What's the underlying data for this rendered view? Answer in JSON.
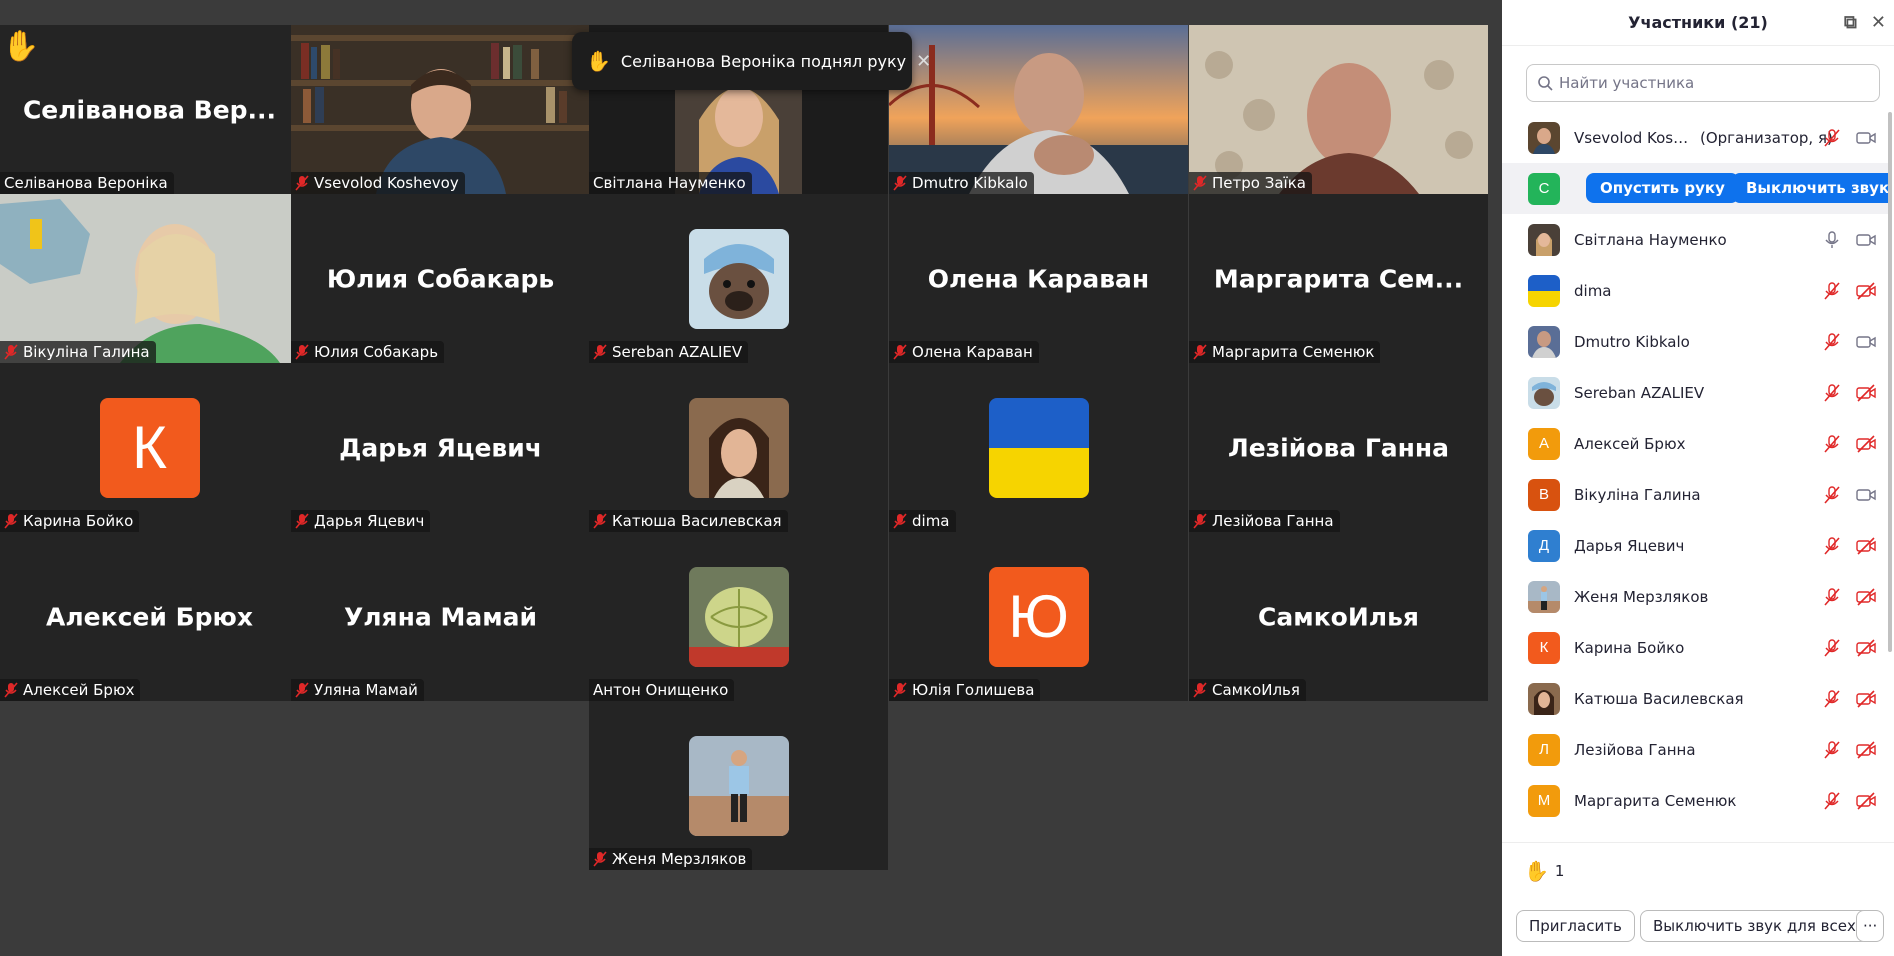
{
  "toast": {
    "text": "Селіванова Вероніка поднял руку"
  },
  "tiles": [
    {
      "label": "Селіванова Вероніка",
      "big": "Селіванова  Вер...",
      "muted": false
    },
    {
      "label": "Vsevolod Koshevoy",
      "muted": true
    },
    {
      "label": "Світлана Науменко",
      "muted": false
    },
    {
      "label": "Dmutro Kibkalo",
      "muted": true
    },
    {
      "label": "Петро Заїка",
      "muted": true
    },
    {
      "label": "Вікуліна Галина",
      "muted": true
    },
    {
      "label": "Юлия Собакарь",
      "big": "Юлия Собакарь",
      "muted": true
    },
    {
      "label": "Sereban AZALIEV",
      "muted": true
    },
    {
      "label": "Олена Караван",
      "big": "Олена Караван",
      "muted": true
    },
    {
      "label": "Маргарита Семенюк",
      "big": "Маргарита  Сем...",
      "muted": true
    },
    {
      "label": "Карина Бойко",
      "avatar_letter": "К",
      "muted": true
    },
    {
      "label": "Дарья Яцевич",
      "big": "Дарья Яцевич",
      "muted": true
    },
    {
      "label": "Катюша Василевская",
      "muted": true
    },
    {
      "label": "dima",
      "muted": true
    },
    {
      "label": "Лезійова Ганна",
      "big": "Лезійова Ганна",
      "muted": true
    },
    {
      "label": "Алексей Брюх",
      "big": "Алексей Брюх",
      "muted": true
    },
    {
      "label": "Уляна Мамай",
      "big": "Уляна Мамай",
      "muted": true
    },
    {
      "label": "Антон Онищенко",
      "muted": false
    },
    {
      "label": "Юлія Голишева",
      "avatar_letter": "Ю",
      "muted": true
    },
    {
      "label": "СамкоИлья",
      "big": "СамкоИлья",
      "muted": true
    },
    {
      "label": "Женя Мерзляков",
      "muted": true
    }
  ],
  "panel": {
    "title": "Участники (21)",
    "search_placeholder": "Найти участника",
    "participants": [
      {
        "name": "Vsevolod Kosh...",
        "role": "(Организатор, я)"
      },
      {
        "name": "",
        "letter": "С"
      },
      {
        "name": "Світлана Науменко"
      },
      {
        "name": "dima"
      },
      {
        "name": "Dmutro Kibkalo"
      },
      {
        "name": "Sereban AZALIEV"
      },
      {
        "name": "Алексей Брюх",
        "letter": "А"
      },
      {
        "name": "Вікуліна Галина",
        "letter": "В"
      },
      {
        "name": "Дарья Яцевич",
        "letter": "Д"
      },
      {
        "name": "Женя Мерзляков"
      },
      {
        "name": "Карина Бойко",
        "letter": "К"
      },
      {
        "name": "Катюша Василевская"
      },
      {
        "name": "Лезійова Ганна",
        "letter": "Л"
      },
      {
        "name": "Маргарита Семенюк",
        "letter": "М"
      }
    ],
    "lower_hand_button": "Опустить руку",
    "mute_button": "Выключить звук",
    "raised_hands_count": "1",
    "invite_button": "Пригласить",
    "mute_all_button": "Выключить звук для всех",
    "more_button": "···"
  },
  "colors": {
    "accent": "#0e72ed",
    "speaking_border": "#23d96c",
    "mute_red": "#e02828",
    "hand_yellow": "#f7b500",
    "orange_avatar": "#f25a1d",
    "green_avatar": "#23b45a",
    "amber_avatar": "#f29b0c",
    "rust_avatar": "#d8520f",
    "blue_avatar": "#2f7fd0"
  }
}
